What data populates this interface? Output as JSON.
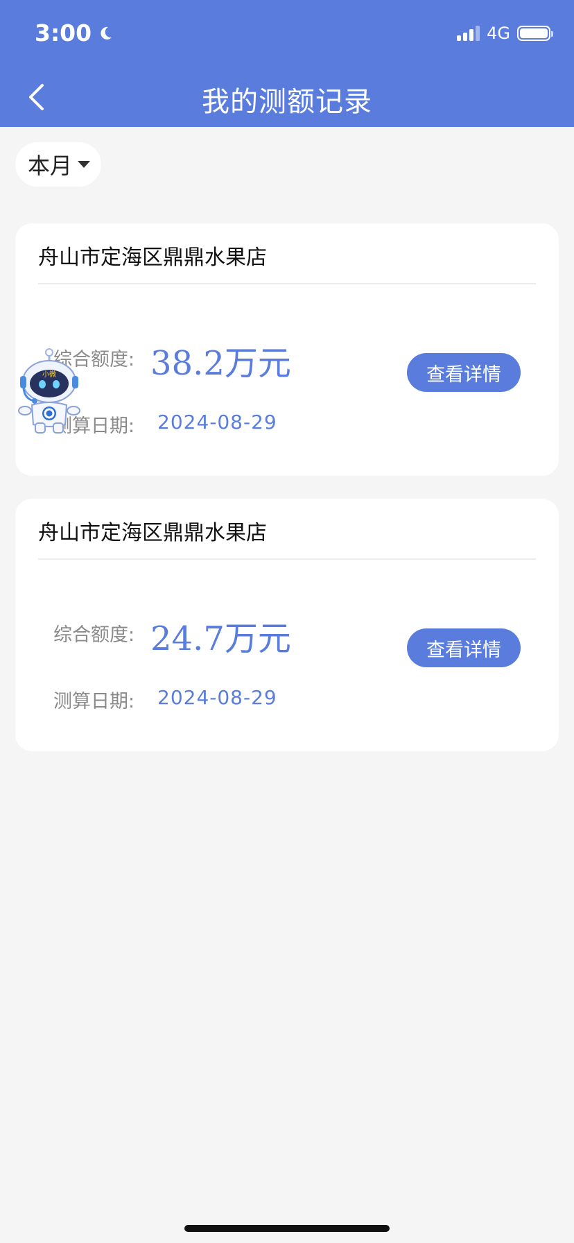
{
  "status_bar": {
    "time": "3:00",
    "network": "4G"
  },
  "header": {
    "title": "我的测额记录"
  },
  "filter": {
    "label": "本月"
  },
  "records": [
    {
      "shop": "舟山市定海区鼎鼎水果店",
      "amount_label": "综合额度:",
      "amount": "38.2万元",
      "date_label": "测算日期:",
      "date": "2024-08-29",
      "button": "查看详情"
    },
    {
      "shop": "舟山市定海区鼎鼎水果店",
      "amount_label": "综合额度:",
      "amount": "24.7万元",
      "date_label": "测算日期:",
      "date": "2024-08-29",
      "button": "查看详情"
    }
  ],
  "mascot": {
    "badge_text": "小微"
  },
  "colors": {
    "primary": "#5a7ddd",
    "background": "#f5f5f5",
    "card": "#ffffff"
  }
}
